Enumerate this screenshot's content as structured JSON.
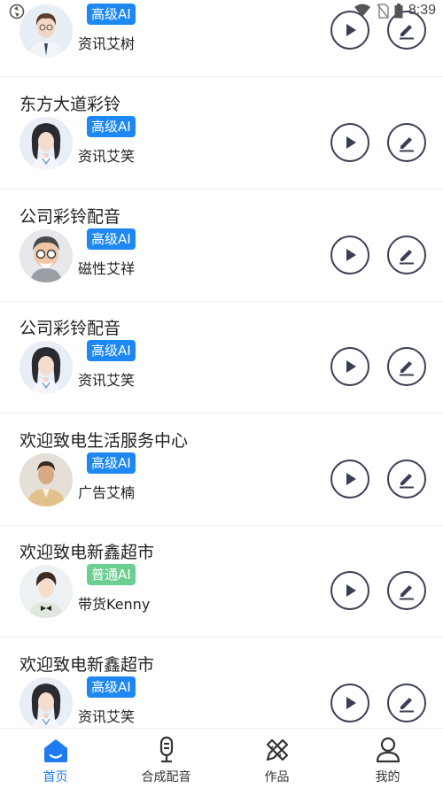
{
  "status_bar": {
    "time": "8:39"
  },
  "items": [
    {
      "title": "",
      "badge": "高级AI",
      "badge_color": "#1e88f2",
      "voice": "资讯艾树",
      "avatar": "male-glasses-avatar"
    },
    {
      "title": "东方大道彩铃",
      "badge": "高级AI",
      "badge_color": "#1e88f2",
      "voice": "资讯艾笑",
      "avatar": "female-avatar"
    },
    {
      "title": "公司彩铃配音",
      "badge": "高级AI",
      "badge_color": "#1e88f2",
      "voice": "磁性艾祥",
      "avatar": "elder-male-avatar"
    },
    {
      "title": "公司彩铃配音",
      "badge": "高级AI",
      "badge_color": "#1e88f2",
      "voice": "资讯艾笑",
      "avatar": "female-avatar"
    },
    {
      "title": "欢迎致电生活服务中心",
      "badge": "高级AI",
      "badge_color": "#1e88f2",
      "voice": "广告艾楠",
      "avatar": "male-avatar"
    },
    {
      "title": "欢迎致电新鑫超市",
      "badge": "普通AI",
      "badge_color": "#6bd08f",
      "voice": "带货Kenny",
      "avatar": "male-bowtie-avatar"
    },
    {
      "title": "欢迎致电新鑫超市",
      "badge": "高级AI",
      "badge_color": "#1e88f2",
      "voice": "资讯艾笑",
      "avatar": "female-avatar"
    }
  ],
  "tabs": [
    {
      "label": "首页",
      "icon": "home-icon",
      "active": true
    },
    {
      "label": "合成配音",
      "icon": "microphone-icon",
      "active": false
    },
    {
      "label": "作品",
      "icon": "pencil-ruler-icon",
      "active": false
    },
    {
      "label": "我的",
      "icon": "user-icon",
      "active": false
    }
  ],
  "colors": {
    "accent": "#1e7cf0",
    "badge_premium": "#1e88f2",
    "badge_basic": "#6bd08f",
    "icon_stroke": "#3a3f55"
  }
}
